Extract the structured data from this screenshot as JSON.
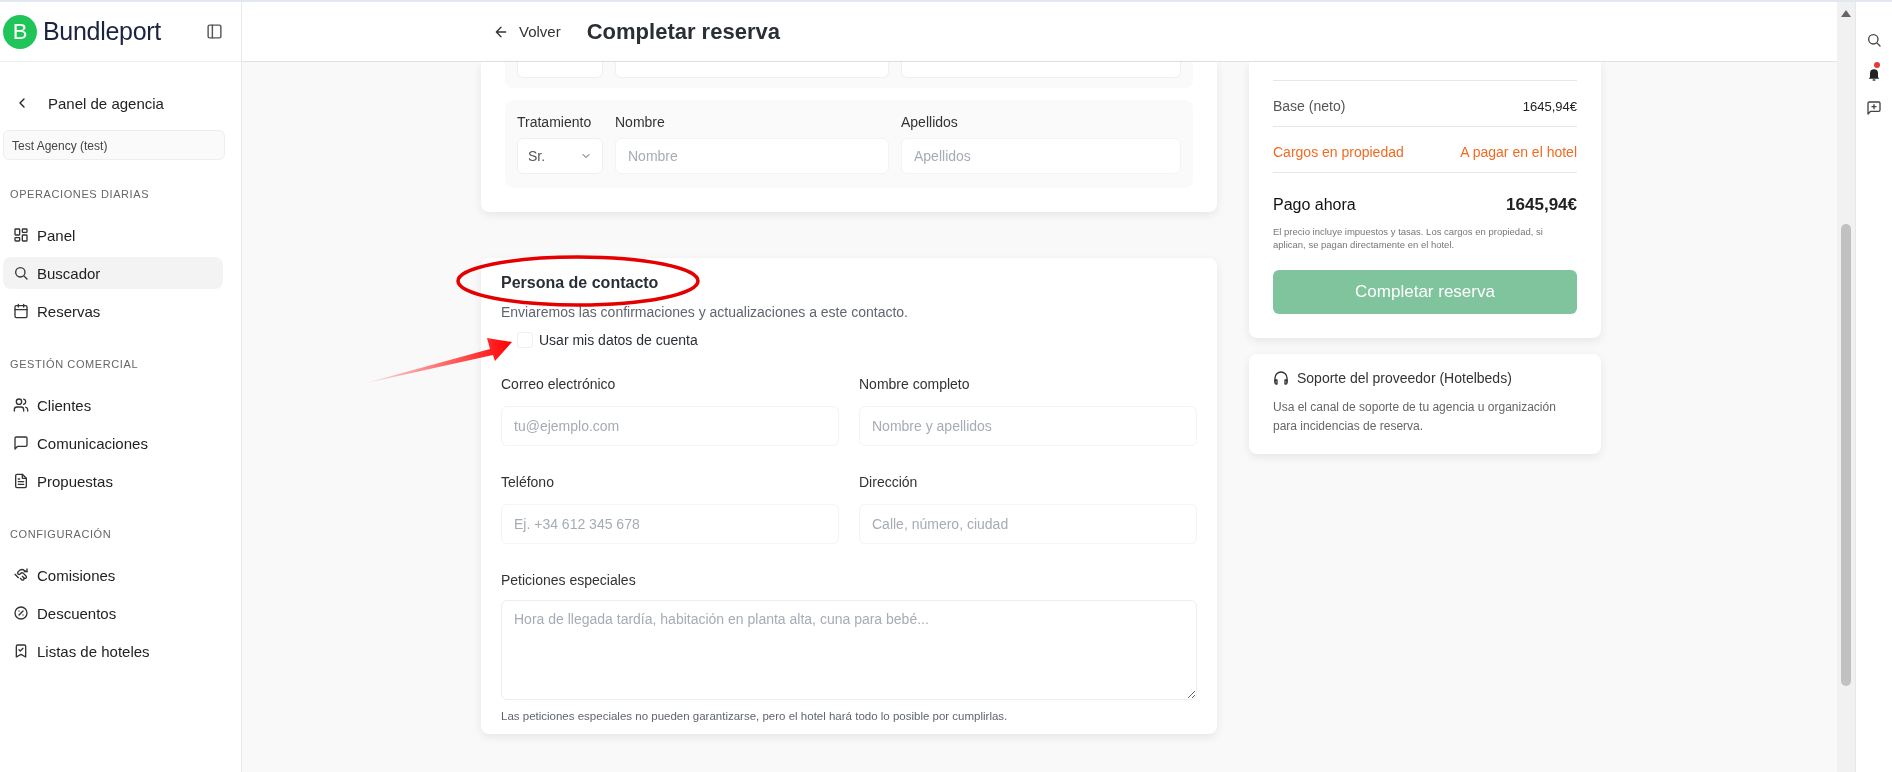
{
  "sidebar": {
    "logo": {
      "mark": "B",
      "name": "Bundleport"
    },
    "back": {
      "label": "Panel de agencia"
    },
    "agency": "Test Agency (test)",
    "sections": [
      {
        "label": "OPERACIONES DIARIAS",
        "items": [
          {
            "label": "Panel",
            "selected": false
          },
          {
            "label": "Buscador",
            "selected": true
          },
          {
            "label": "Reservas",
            "selected": false
          }
        ]
      },
      {
        "label": "GESTIÓN COMERCIAL",
        "items": [
          {
            "label": "Clientes",
            "selected": false
          },
          {
            "label": "Comunicaciones",
            "selected": false
          },
          {
            "label": "Propuestas",
            "selected": false
          }
        ]
      },
      {
        "label": "CONFIGURACIÓN",
        "items": [
          {
            "label": "Comisiones",
            "selected": false
          },
          {
            "label": "Descuentos",
            "selected": false
          },
          {
            "label": "Listas de hoteles",
            "selected": false
          }
        ]
      }
    ]
  },
  "header": {
    "back": "Volver",
    "title": "Completar reserva"
  },
  "guests": {
    "rows": [
      {
        "kind": "cut"
      },
      {
        "kind": "full",
        "treatment_label": "Tratamiento",
        "name_label": "Nombre",
        "surname_label": "Apellidos",
        "treatment": "Sr.",
        "name_placeholder": "Nombre",
        "surname_placeholder": "Apellidos"
      }
    ]
  },
  "contact": {
    "title": "Persona de contacto",
    "subtitle": "Enviaremos las confirmaciones y actualizaciones a este contacto.",
    "use_account": {
      "label": "Usar mis datos de cuenta",
      "checked": false
    },
    "fields": [
      {
        "label": "Correo electrónico",
        "placeholder": "tu@ejemplo.com"
      },
      {
        "label": "Nombre completo",
        "placeholder": "Nombre y apellidos"
      },
      {
        "label": "Teléfono",
        "placeholder": "Ej. +34 612 345 678"
      },
      {
        "label": "Dirección",
        "placeholder": "Calle, número, ciudad"
      }
    ],
    "requests": {
      "label": "Peticiones especiales",
      "placeholder": "Hora de llegada tardía, habitación en planta alta, cuna para bebé...",
      "hint": "Las peticiones especiales no pueden garantizarse, pero el hotel hará todo lo posible por cumplirlas."
    }
  },
  "summary": {
    "rows": [
      {
        "kind": "normal",
        "label": "Base (neto)",
        "value": "1645,94€"
      },
      {
        "kind": "warning",
        "label": "Cargos en propiedad",
        "value": "A pagar en el hotel"
      },
      {
        "kind": "total",
        "label": "Pago ahora",
        "value": "1645,94€"
      }
    ],
    "note": "El precio incluye impuestos y tasas. Los cargos en propiedad, si aplican, se pagan directamente en el hotel.",
    "button": {
      "label": "Completar reserva",
      "disabled": true
    }
  },
  "support": {
    "title": "Soporte del proveedor (Hotelbeds)",
    "text": "Usa el canal de soporte de tu agencia u organización para incidencias de reserva."
  },
  "rail": {
    "notification": true
  }
}
